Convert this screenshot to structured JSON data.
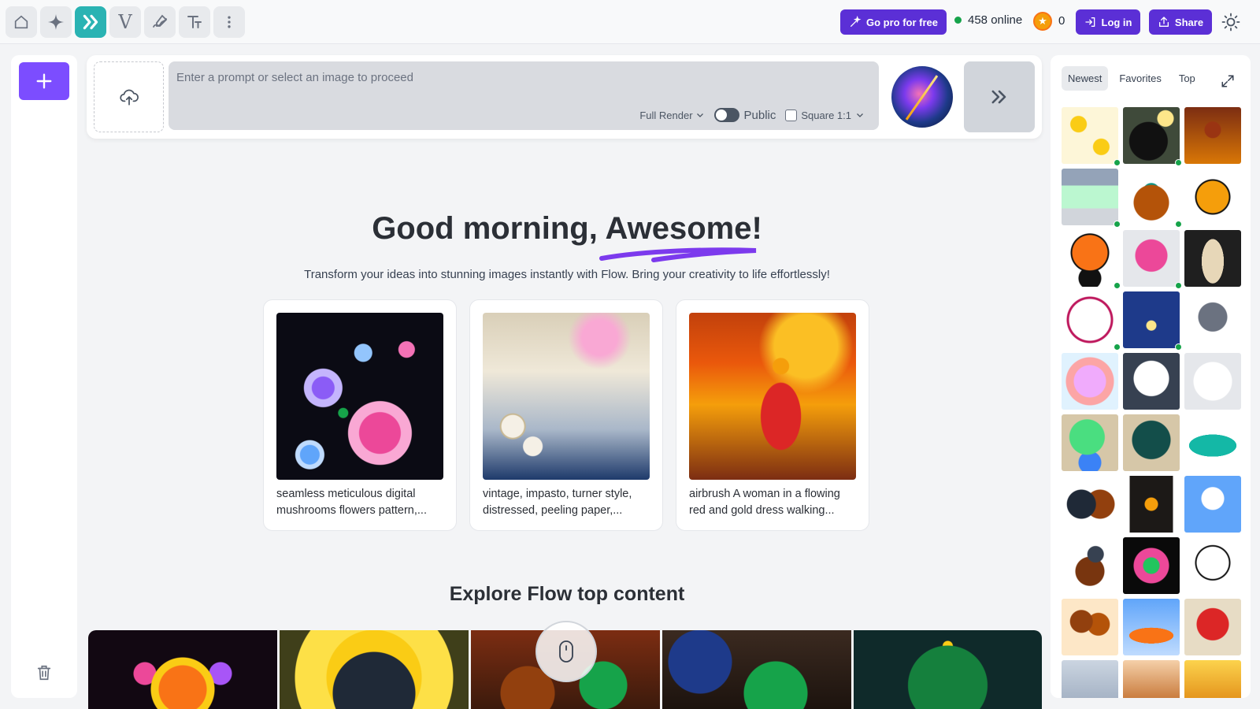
{
  "topbar": {
    "tools": [
      {
        "name": "home-icon",
        "active": false
      },
      {
        "name": "sparkle-icon",
        "active": false
      },
      {
        "name": "flow-chevrons-icon",
        "active": true
      },
      {
        "name": "v-logo-icon",
        "active": false
      },
      {
        "name": "draw-icon",
        "active": false
      },
      {
        "name": "text-icon",
        "active": false
      },
      {
        "name": "more-vertical-icon",
        "active": false
      }
    ],
    "pro_label": "Go pro for free",
    "online_label": "458 online",
    "coin_count": "0",
    "login_label": "Log in",
    "share_label": "Share",
    "accent": "#5b2fd6"
  },
  "leftbar": {
    "new_icon": "plus-icon",
    "trash_icon": "trash-icon"
  },
  "prompt": {
    "placeholder": "Enter a prompt or select an image to proceed",
    "value": "",
    "render_label": "Full Render",
    "public_label": "Public",
    "square_label": "Square 1:1"
  },
  "hero": {
    "greeting": "Good morning,",
    "name": "Awesome!",
    "subtitle": "Transform your ideas into stunning images instantly with Flow. Bring your creativity to life effortlessly!"
  },
  "suggestions": [
    {
      "caption": "seamless meticulous digital mushrooms flowers pattern,..."
    },
    {
      "caption": "vintage, impasto, turner style, distressed, peeling paper,..."
    },
    {
      "caption": "airbrush A woman in a flowing red and gold dress walking..."
    }
  ],
  "explore": {
    "title": "Explore Flow top content"
  },
  "gallery": {
    "tabs": [
      "Newest",
      "Favorites",
      "Top"
    ],
    "active_tab": "Newest"
  }
}
